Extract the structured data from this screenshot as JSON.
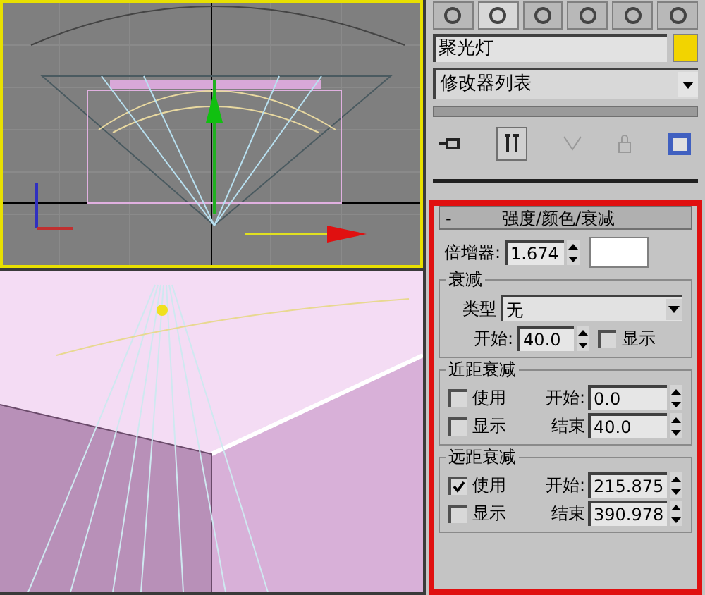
{
  "tabs": [
    {
      "selected": false
    },
    {
      "selected": true
    },
    {
      "selected": false
    },
    {
      "selected": false
    },
    {
      "selected": false
    },
    {
      "selected": false
    }
  ],
  "object_name": "聚光灯",
  "modifier_list": "修改器列表",
  "rollout": {
    "collapse_sign": "-",
    "title": "强度/颜色/衰减"
  },
  "multiplier": {
    "label": "倍增器:",
    "value": "1.674"
  },
  "decay": {
    "title": "衰减",
    "type_label": "类型",
    "type_value": "无",
    "start_label": "开始:",
    "start_value": "40.0",
    "show": {
      "label": "显示",
      "checked": false
    }
  },
  "attenuation": [
    {
      "title": "近距衰减",
      "use": {
        "label": "使用",
        "checked": false
      },
      "show": {
        "label": "显示",
        "checked": false
      },
      "start_label": "开始:",
      "start_value": "0.0",
      "end_label": "结束",
      "end_value": "40.0"
    },
    {
      "title": "远距衰减",
      "use": {
        "label": "使用",
        "checked": true
      },
      "show": {
        "label": "显示",
        "checked": false
      },
      "start_label": "开始:",
      "start_value": "215.875",
      "end_label": "结束",
      "end_value": "390.978"
    }
  ]
}
